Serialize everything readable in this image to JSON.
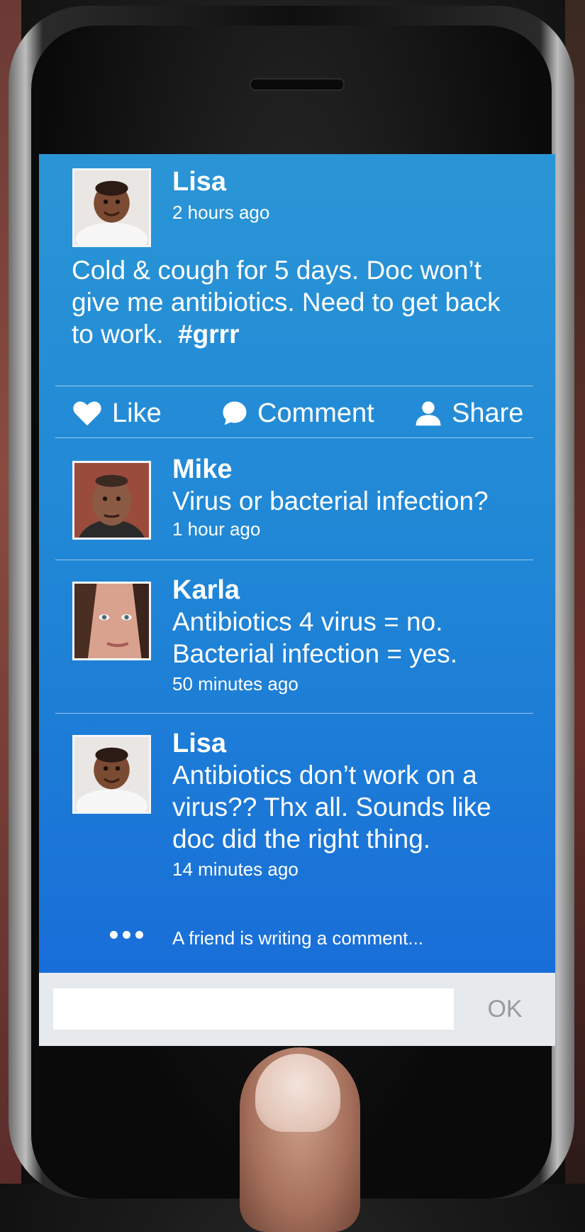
{
  "post": {
    "author": "Lisa",
    "time": "2 hours ago",
    "text": "Cold & cough for 5 days. Doc won’t give me antibiotics. Need to get back to work.",
    "hashtag": "#grrr"
  },
  "actions": {
    "like": "Like",
    "comment": "Comment",
    "share": "Share"
  },
  "comments": [
    {
      "author": "Mike",
      "text": "Virus or bacterial infection?",
      "time": "1 hour ago"
    },
    {
      "author": "Karla",
      "line1": "Antibiotics 4 virus = no.",
      "line2": "Bacterial infection = yes.",
      "time": "50 minutes ago"
    },
    {
      "author": "Lisa",
      "line1": "Antibiotics don’t work on a",
      "line2": "virus?? Thx all. Sounds like",
      "line3": "doc did the right thing.",
      "time": "14 minutes ago"
    }
  ],
  "typing_indicator": "A friend is writing a comment...",
  "composer": {
    "value": "",
    "ok_label": "OK"
  },
  "colors": {
    "screen_top": "#2a95d6",
    "screen_bottom": "#176ad8",
    "composer_bg": "#e7eaec"
  },
  "icons": [
    "heart-icon",
    "speech-bubble-icon",
    "person-icon",
    "typing-dots-icon"
  ]
}
